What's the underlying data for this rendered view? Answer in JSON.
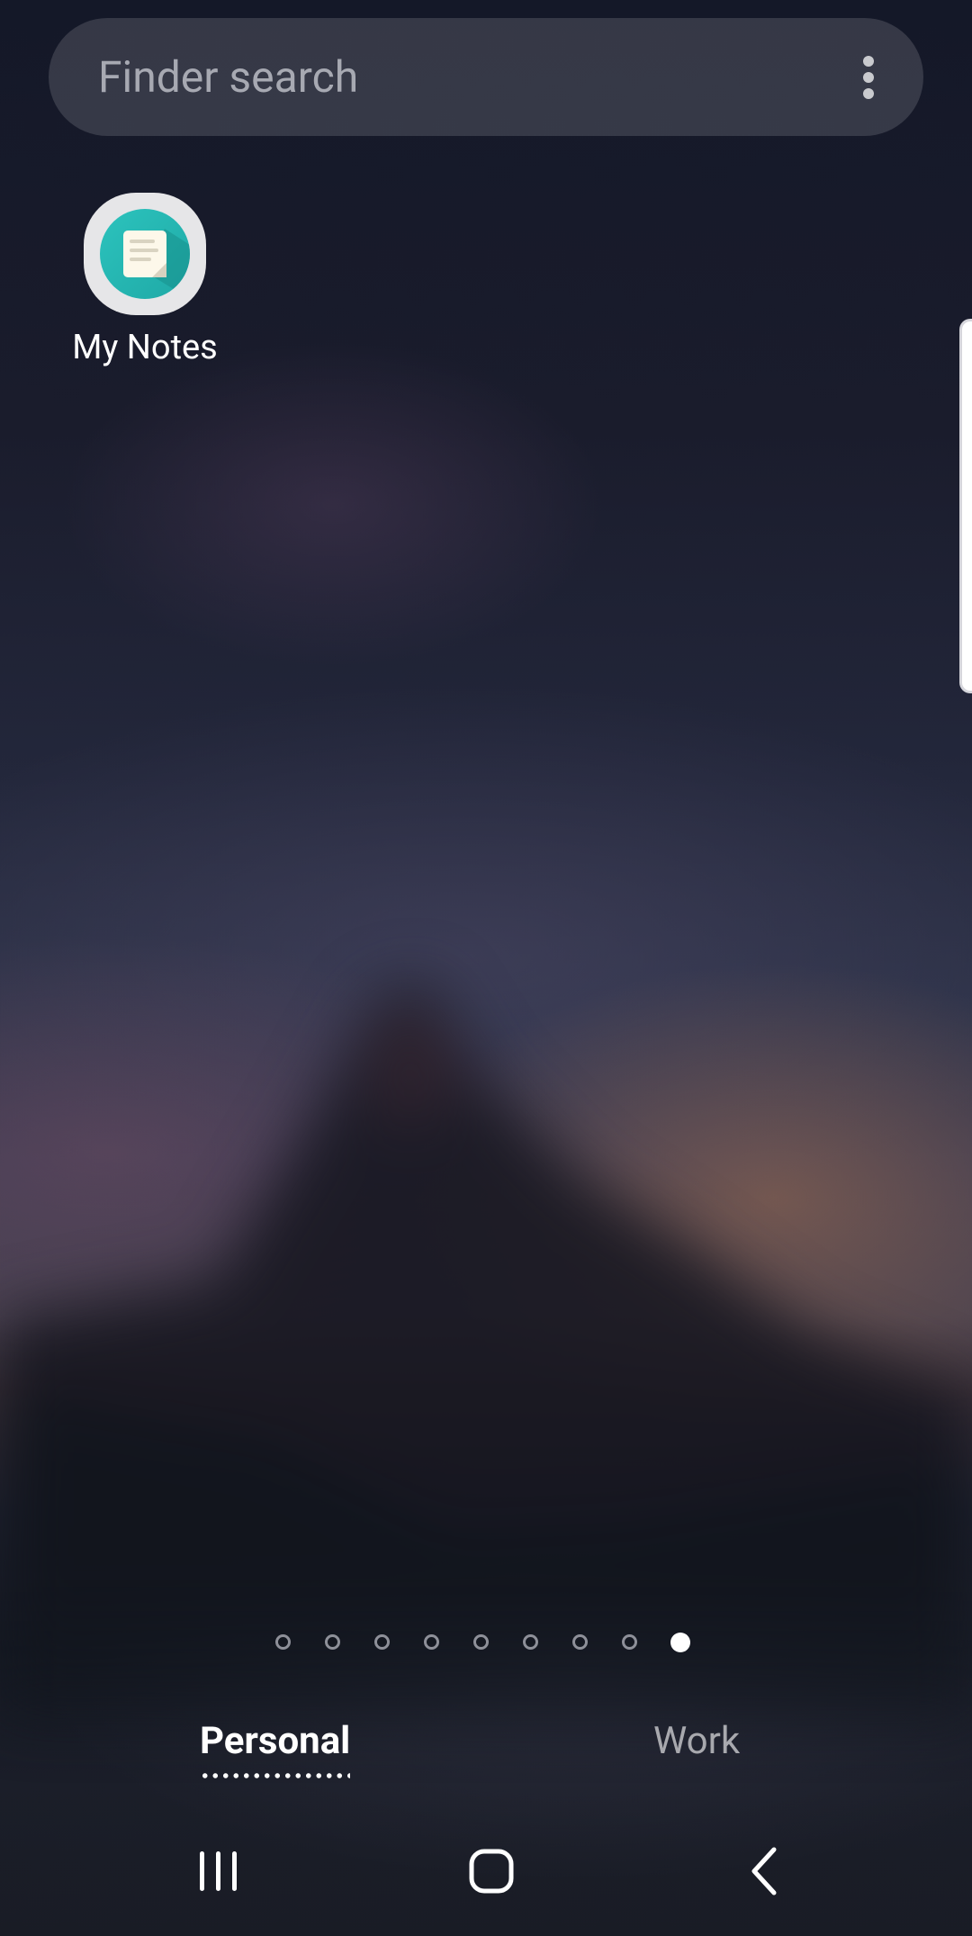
{
  "search": {
    "placeholder": "Finder search",
    "more_icon": "more-vertical-icon"
  },
  "apps": [
    {
      "label": "My Notes",
      "icon": "my-notes-app-icon"
    }
  ],
  "edge_panel": {
    "icon": "edge-panel-handle"
  },
  "pages": {
    "count": 9,
    "current": 9
  },
  "tabs": {
    "personal": "Personal",
    "work": "Work",
    "selected": "Personal"
  },
  "nav": {
    "recents_icon": "recents-icon",
    "home_icon": "home-icon",
    "back_icon": "back-icon"
  },
  "colors": {
    "accent_note": "#2cc3bd",
    "tab_active": "#ffffff",
    "tab_inactive": "#a8a9ae"
  }
}
